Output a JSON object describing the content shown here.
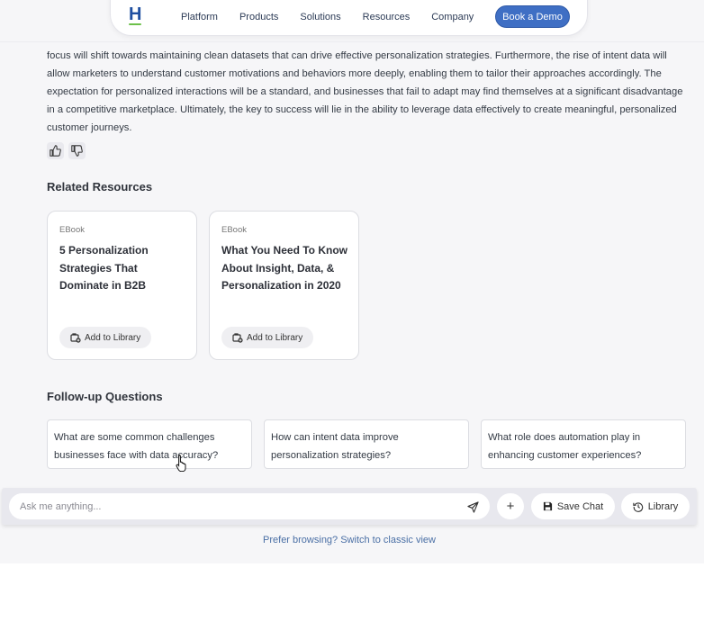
{
  "nav": {
    "logo": "H",
    "links": [
      "Platform",
      "Products",
      "Solutions",
      "Resources",
      "Company"
    ],
    "cta": "Book a Demo"
  },
  "answer": {
    "text": "focus will shift towards maintaining clean datasets that can drive effective personalization strategies. Furthermore, the rise of intent data will allow marketers to understand customer motivations and behaviors more deeply, enabling them to tailor their approaches accordingly. The expectation for personalized interactions will be a standard, and businesses that fail to adapt may find themselves at a significant disadvantage in a competitive marketplace. Ultimately, the key to success will lie in the ability to leverage data effectively to create meaningful, personalized customer journeys."
  },
  "feedback": {
    "up_icon": "thumbs-up-icon",
    "down_icon": "thumbs-down-icon"
  },
  "related": {
    "title": "Related Resources",
    "cards": [
      {
        "type": "EBook",
        "title": "5 Personalization Strategies That Dominate in B2B",
        "action": "Add to Library"
      },
      {
        "type": "EBook",
        "title": "What You Need To Know About Insight, Data, & Personalization in 2020",
        "action": "Add to Library"
      }
    ]
  },
  "followup": {
    "title": "Follow-up Questions",
    "questions": [
      "What are some common challenges businesses face with data accuracy?",
      "How can intent data improve personalization strategies?",
      "What role does automation play in enhancing customer experiences?"
    ]
  },
  "chat": {
    "placeholder": "Ask me anything...",
    "add_label": "+",
    "save_label": "Save Chat",
    "library_label": "Library"
  },
  "footer": {
    "classic_link": "Prefer browsing? Switch to classic view"
  },
  "colors": {
    "accent": "#3f6fc4",
    "background": "#f6f6f8",
    "link": "#4a6fa5"
  }
}
